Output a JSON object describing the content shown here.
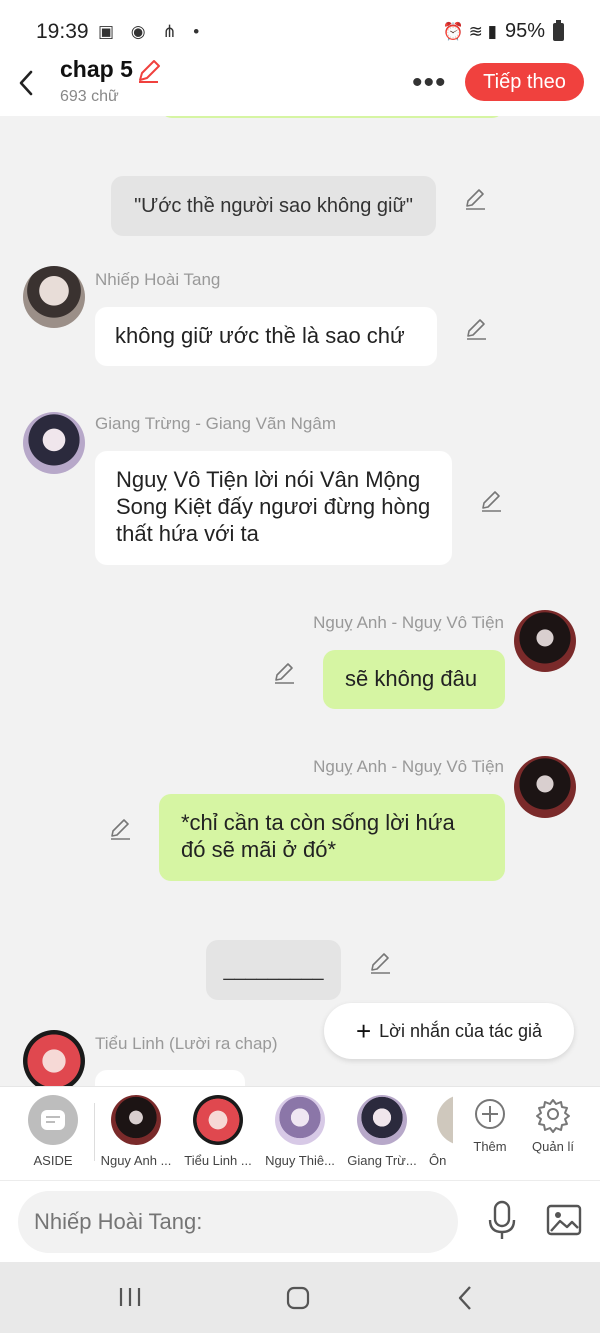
{
  "status_bar": {
    "time": "19:39",
    "left_icons": [
      "image-icon",
      "owl-icon",
      "signal-icon",
      "dot"
    ],
    "battery": "95%"
  },
  "header": {
    "title": "chap 5",
    "word_count": "693 chữ",
    "more_label": "•••",
    "next_label": "Tiếp theo"
  },
  "messages": [
    {
      "type": "narration",
      "text": "\"Ước thề người sao không giữ\""
    },
    {
      "type": "left",
      "sender": "Nhiếp Hoài Tang",
      "text": "không giữ ước thề là sao chứ"
    },
    {
      "type": "left",
      "sender": "Giang Trừng - Giang Vãn Ngâm",
      "text": "Nguỵ Vô Tiện lời nói Vân Mộng Song Kiệt đấy ngươi đừng hòng thất hứa với ta"
    },
    {
      "type": "right",
      "sender": "Nguỵ Anh - Nguỵ Vô Tiện",
      "text": "sẽ không đâu"
    },
    {
      "type": "right",
      "sender": "Nguỵ Anh - Nguỵ Vô Tiện",
      "text": "*chỉ cần ta còn sống lời hứa đó sẽ mãi ở đó*"
    },
    {
      "type": "narration",
      "text": "_________"
    },
    {
      "type": "left",
      "sender": "Tiểu Linh (Lười ra chap)",
      "text": ""
    }
  ],
  "author_note_label": "Lời nhắn của tác giả",
  "characters": [
    {
      "label": "ASIDE"
    },
    {
      "label": "Nguy Anh ..."
    },
    {
      "label": "Tiểu Linh ..."
    },
    {
      "label": "Nguy Thiê..."
    },
    {
      "label": "Giang Trừ..."
    },
    {
      "label": "Ôn"
    }
  ],
  "char_actions": {
    "add_label": "Thêm",
    "manage_label": "Quản lí"
  },
  "input": {
    "placeholder": "Nhiếp Hoài Tang:"
  },
  "colors": {
    "accent": "#f0413e",
    "green_bubble": "#d6f5a3",
    "gray_bubble": "#e4e4e4"
  }
}
